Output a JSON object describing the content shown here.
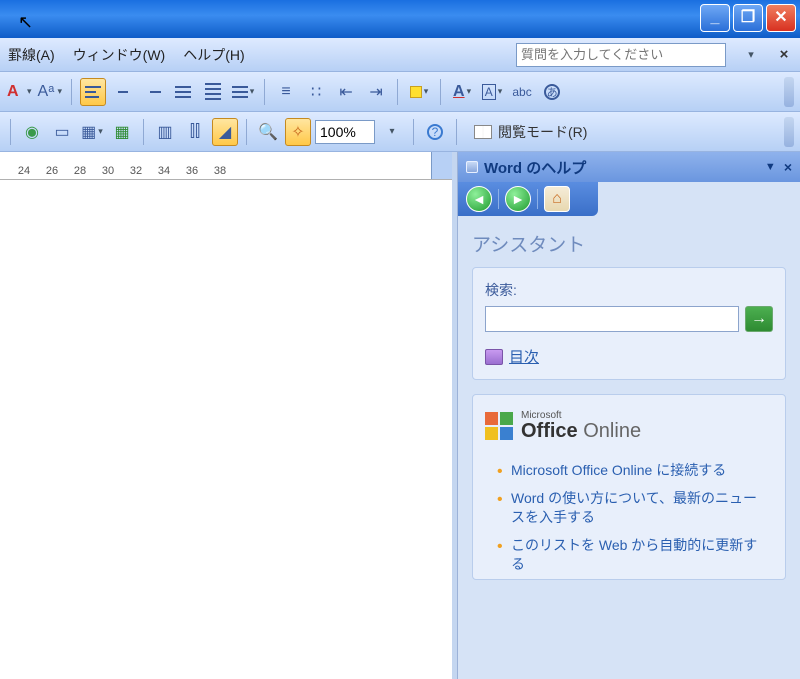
{
  "window": {
    "min_label": "_",
    "max_label": "❐",
    "close_label": "✕"
  },
  "menu": {
    "table": "罫線(A)",
    "window": "ウィンドウ(W)",
    "help": "ヘルプ(H)",
    "ask_placeholder": "質問を入力してください"
  },
  "format_toolbar": {
    "font_color": "A",
    "char_scale": "Aᵃ",
    "highlight_a": "A",
    "char_border": "A",
    "underline_abc": "abc"
  },
  "toolbar": {
    "zoom_value": "100%",
    "reading_mode_label": "閲覧モード(R)"
  },
  "ruler": {
    "ticks": [
      "24",
      "26",
      "28",
      "30",
      "32",
      "34",
      "36",
      "38"
    ]
  },
  "help": {
    "title": "Word のヘルプ",
    "assistant_heading": "アシスタント",
    "search_label": "検索:",
    "search_value": "",
    "toc_label": "目次",
    "office_ms": "Microsoft",
    "office_brand": "Office",
    "office_online": "Online",
    "links": [
      "Microsoft Office Online に接続する",
      "Word の使い方について、最新のニュースを入手する",
      "このリストを Web から自動的に更新する"
    ]
  }
}
